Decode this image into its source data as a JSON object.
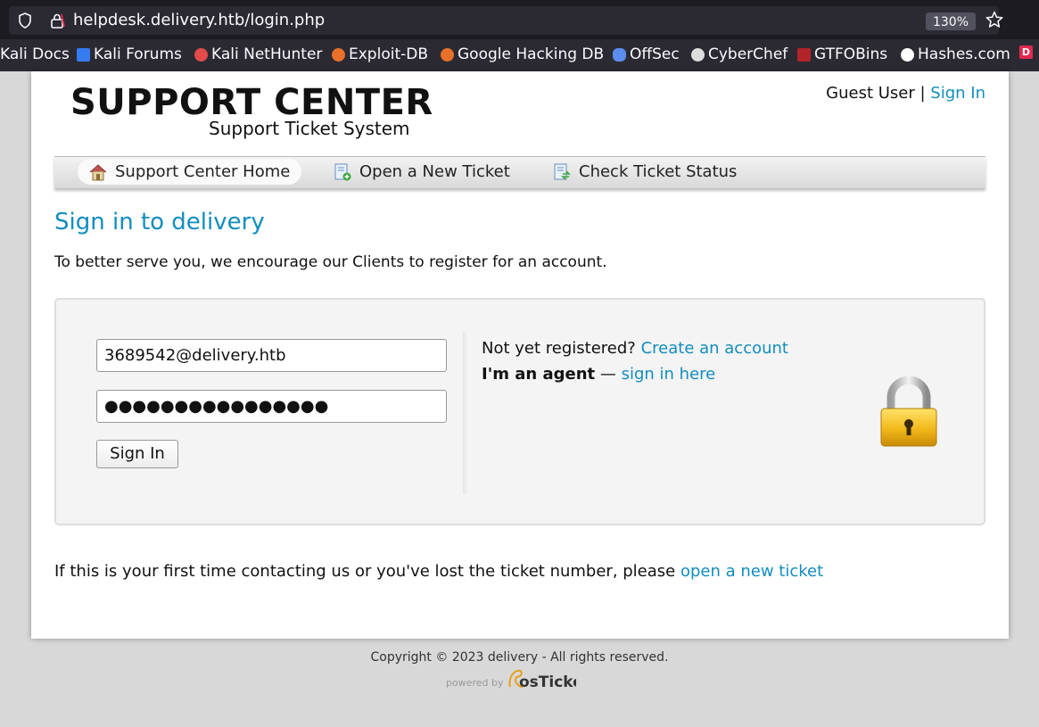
{
  "browser": {
    "url": "helpdesk.delivery.htb/login.php",
    "zoom": "130%",
    "bookmarks": [
      {
        "label": "Kali Docs",
        "icon": "kali-icon",
        "color": "#2b2a33"
      },
      {
        "label": "Kali Forums",
        "icon": "kali-forums-icon",
        "color": "#367bf0"
      },
      {
        "label": "Kali NetHunter",
        "icon": "nethunter-icon",
        "color": "#e34b4b"
      },
      {
        "label": "Exploit-DB",
        "icon": "exploitdb-icon",
        "color": "#e8702a"
      },
      {
        "label": "Google Hacking DB",
        "icon": "ghdb-icon",
        "color": "#e8702a"
      },
      {
        "label": "OffSec",
        "icon": "offsec-icon",
        "color": "#5b8def"
      },
      {
        "label": "CyberChef",
        "icon": "cyberchef-icon",
        "color": "#dddddd"
      },
      {
        "label": "GTFOBins",
        "icon": "gtfobins-icon",
        "color": "#b2232a"
      },
      {
        "label": "Hashes.com",
        "icon": "hashes-icon",
        "color": "#ffffff"
      }
    ],
    "bookmark_overflow_icon": "D"
  },
  "header": {
    "logo_title": "SUPPORT CENTER",
    "logo_subtitle": "Support Ticket System",
    "guest_user": "Guest User |",
    "sign_in_link": "Sign In"
  },
  "nav": {
    "items": [
      {
        "label": "Support Center Home",
        "icon": "home-icon"
      },
      {
        "label": "Open a New Ticket",
        "icon": "new-ticket-icon"
      },
      {
        "label": "Check Ticket Status",
        "icon": "ticket-status-icon"
      }
    ]
  },
  "main": {
    "title": "Sign in to delivery",
    "intro": "To better serve you, we encourage our Clients to register for an account.",
    "username_value": "3689542@delivery.htb",
    "password_mask": "●●●●●●●●●●●●●●●●",
    "sign_in_button": "Sign In",
    "not_registered": "Not yet registered?",
    "create_account_link": "Create an account",
    "agent_label": "I'm an agent",
    "agent_dash": "—",
    "agent_link": "sign in here",
    "bottom_text": "If this is your first time contacting us or you've lost the ticket number, please",
    "bottom_link": "open a new ticket"
  },
  "footer": {
    "copyright": "Copyright © 2023 delivery - All rights reserved.",
    "powered_by": "powered by",
    "brand": "osTicket"
  },
  "colors": {
    "link": "#128dbe",
    "chrome_bg": "#1c1b22",
    "toolbar_bg": "#2b2a33"
  }
}
